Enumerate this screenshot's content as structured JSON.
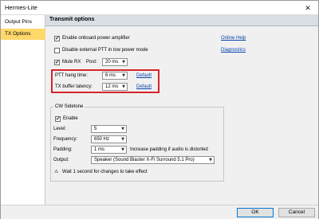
{
  "window": {
    "title": "Hermes-Lite"
  },
  "sidebar": {
    "items": [
      {
        "label": "Output Pins"
      },
      {
        "label": "TX Options"
      }
    ]
  },
  "panel": {
    "header": "Transmit options"
  },
  "options": {
    "enable_onboard_pa": {
      "label": "Enable onboard power amplifier",
      "checked": true
    },
    "disable_ext_ptt": {
      "label": "Disable external PTT in low power mode",
      "checked": false
    },
    "mute_rx": {
      "label": "Mute RX",
      "checked": true,
      "post_label": "Post:",
      "post_value": "20 ms"
    }
  },
  "links": {
    "online_help": "Online Help",
    "diagnostics": "Diagnostics"
  },
  "ptt": {
    "label": "PTT hang time:",
    "value": "6 ms",
    "default_link": "Default"
  },
  "tx_buffer": {
    "label": "TX buffer latency:",
    "value": "12 ms",
    "default_link": "Default"
  },
  "cw_sidetone": {
    "title": "CW Sidetone",
    "enable": {
      "label": "Enable",
      "checked": true
    },
    "level": {
      "label": "Level:",
      "value": "5"
    },
    "frequency": {
      "label": "Frequency:",
      "value": "650 Hz"
    },
    "padding": {
      "label": "Padding:",
      "value": "1 ms",
      "hint": "Increase padding if audio is distorted"
    },
    "output": {
      "label": "Output:",
      "value": "Speaker (Sound Blaster X-Fi Surround 5.1 Pro)"
    },
    "warning": "Wait 1 second for changes to take effect"
  },
  "footer": {
    "ok": "OK",
    "cancel": "Cancel"
  },
  "colors": {
    "highlight": "#d6242b",
    "active_tab": "#ffd86a",
    "link": "#0645ad"
  }
}
